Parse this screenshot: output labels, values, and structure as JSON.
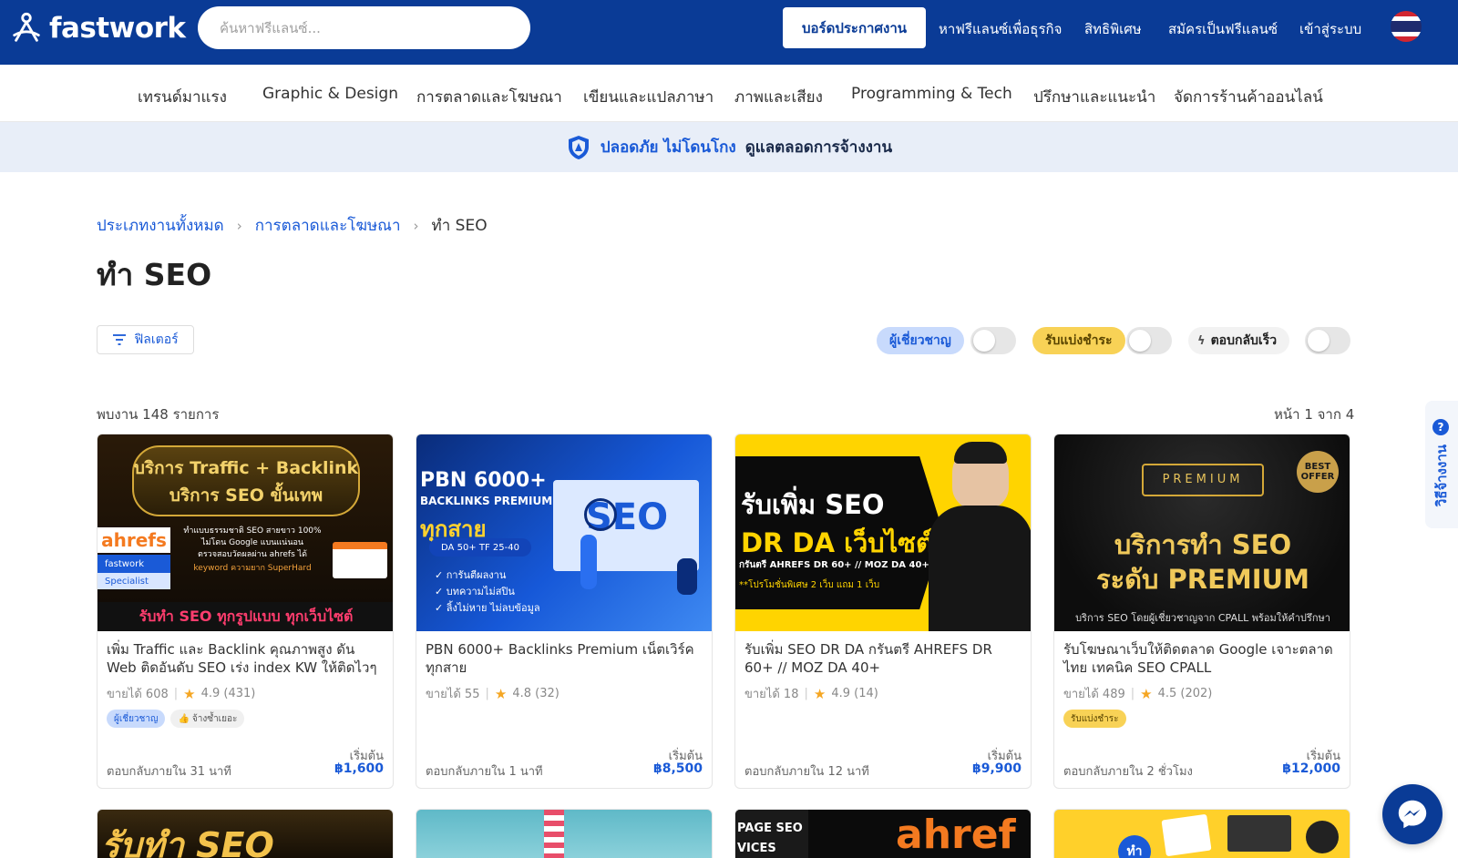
{
  "header": {
    "brand": "fastwork",
    "search_placeholder": "ค้นหาฟรีแลนซ์...",
    "post_job": "บอร์ดประกาศงาน",
    "nav": [
      "หาฟรีแลนซ์เพื่อธุรกิจ",
      "สิทธิพิเศษ",
      "สมัครเป็นฟรีแลนซ์",
      "เข้าสู่ระบบ"
    ]
  },
  "categories": [
    "เทรนด์มาแรง",
    "Graphic & Design",
    "การตลาดและโฆษณา",
    "เขียนและแปลภาษา",
    "ภาพและเสียง",
    "Programming & Tech",
    "ปรึกษาและแนะนำ",
    "จัดการร้านค้าออนไลน์"
  ],
  "banner": {
    "highlight": "ปลอดภัย ไม่โดนโกง",
    "text": "ดูแลตลอดการจ้างงาน"
  },
  "breadcrumb": {
    "root": "ประเภทงานทั้งหมด",
    "parent": "การตลาดและโฆษณา",
    "current": "ทำ SEO"
  },
  "page_title": "ทำ SEO",
  "filters": {
    "button": "ฟิลเตอร์",
    "expert": "ผู้เชี่ยวชาญ",
    "installment": "รับแบ่งชำระ",
    "fast_reply": "ตอบกลับเร็ว"
  },
  "results": {
    "found": "พบงาน 148 รายการ",
    "page": "หน้า 1 จาก 4"
  },
  "cards": [
    {
      "thumb_lines": [
        "บริการ Traffic + Backlink",
        "บริการ SEO ขั้นเทพ"
      ],
      "title": "เพิ่ม Traffic และ Backlink คุณภาพสูง ดัน Web ติดอันดับ SEO เร่ง index KW ให้ติดไวๆ",
      "sold": "ขายได้ 608",
      "rating": "4.9 (431)",
      "tags": [
        "ผู้เชี่ยวชาญ",
        "จ้างซ้ำเยอะ"
      ],
      "response": "ตอบกลับภายใน 31 นาที",
      "from": "เริ่มต้น",
      "price": "฿1,600"
    },
    {
      "thumb_lines": [
        "PBN 6000+",
        "BACKLINKS PREMIUM"
      ],
      "title": "PBN 6000+ Backlinks Premium เน็ตเวิร์ค ทุกสาย",
      "sold": "ขายได้ 55",
      "rating": "4.8 (32)",
      "tags": [],
      "response": "ตอบกลับภายใน 1 นาที",
      "from": "เริ่มต้น",
      "price": "฿8,500"
    },
    {
      "thumb_lines": [
        "รับเพิ่ม SEO",
        "DR DA เว็บไซต์"
      ],
      "title": "รับเพิ่ม SEO DR DA กรันตรี AHREFS DR 60+ // MOZ DA 40+",
      "sold": "ขายได้ 18",
      "rating": "4.9 (14)",
      "tags": [],
      "response": "ตอบกลับภายใน 12 นาที",
      "from": "เริ่มต้น",
      "price": "฿9,900"
    },
    {
      "thumb_lines": [
        "PREMIUM",
        "บริการทำ SEO",
        "ระดับ PREMIUM"
      ],
      "title": "รับโฆษณาเว็บให้ติดตลาด Google เจาะตลาดไทย เทคนิค SEO CPALL",
      "sold": "ขายได้ 489",
      "rating": "4.5 (202)",
      "tags": [
        "รับแบ่งชำระ"
      ],
      "response": "ตอบกลับภายใน 2 ชั่วโมง",
      "from": "เริ่มต้น",
      "price": "฿12,000"
    }
  ],
  "bottom_row": [
    "รับทำ SEO",
    "",
    "ahref",
    "ทำ"
  ],
  "side": {
    "guide": "วิธีจ้างงาน",
    "guide_icon": "?"
  },
  "colors": {
    "primary": "#0a3b96",
    "link": "#1a5ad7",
    "expert": "#c8dafc",
    "installment": "#f8d256"
  }
}
